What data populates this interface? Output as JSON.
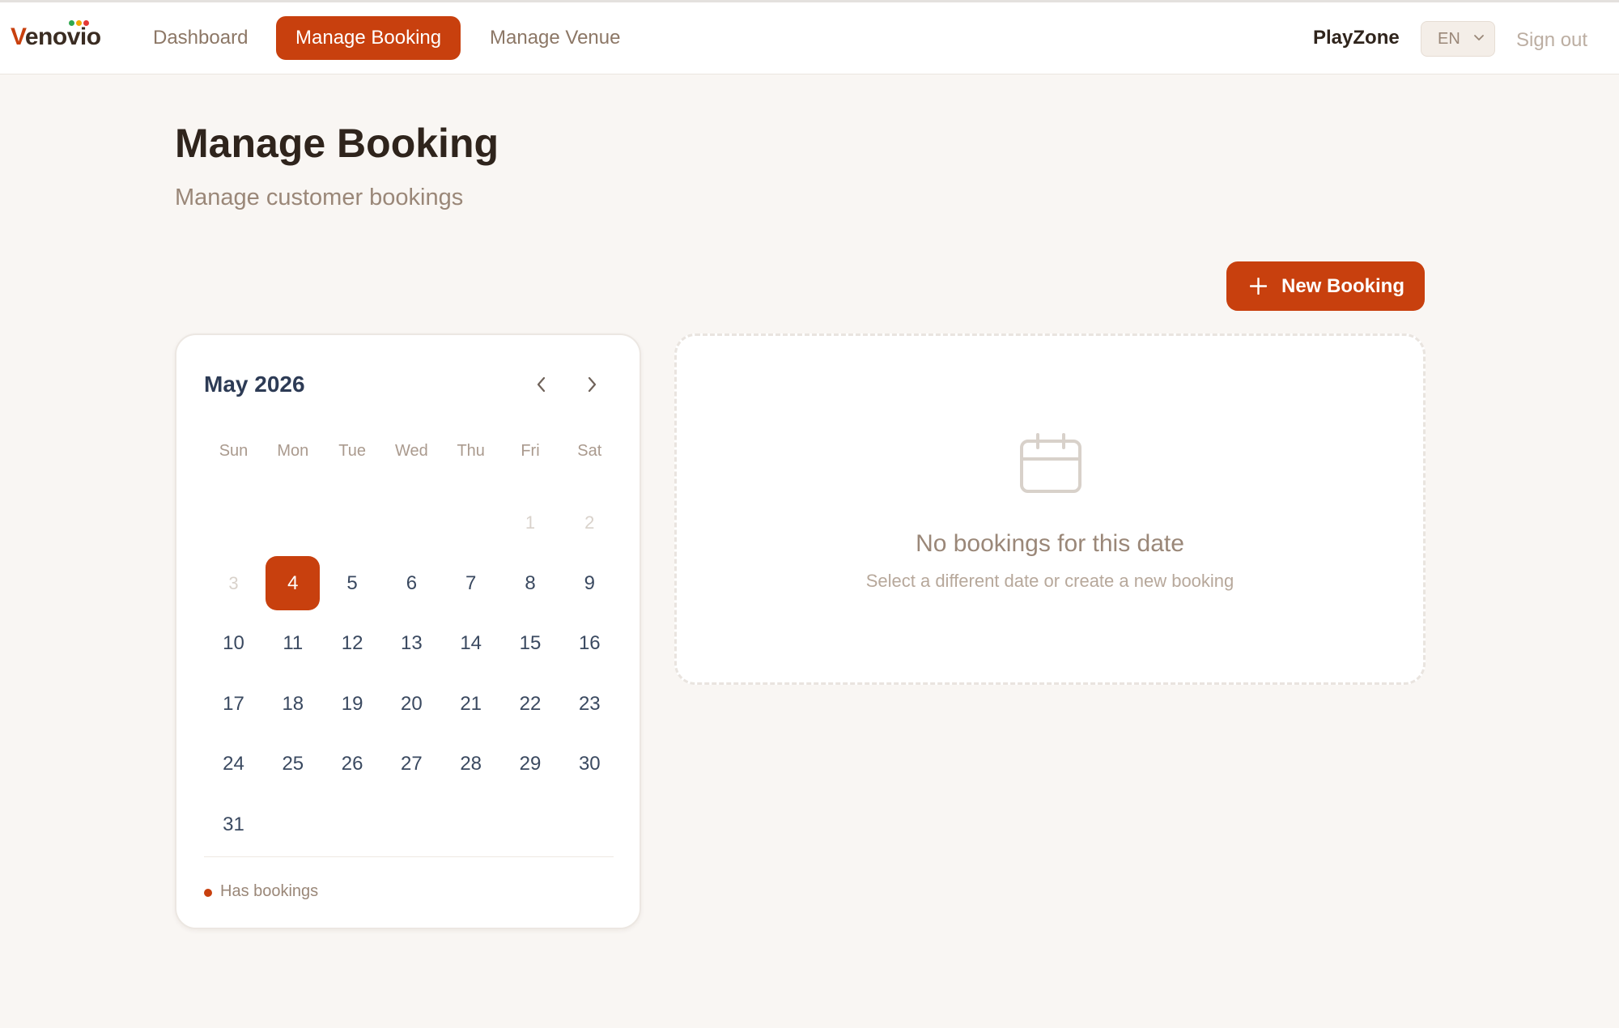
{
  "app": {
    "logo_text": "Venovio",
    "logo_first": "V",
    "logo_rest": "enovio"
  },
  "nav": {
    "items": [
      {
        "label": "Dashboard",
        "active": false
      },
      {
        "label": "Manage Booking",
        "active": true
      },
      {
        "label": "Manage Venue",
        "active": false
      }
    ],
    "brand_name": "PlayZone",
    "language": "EN",
    "sign_out": "Sign out"
  },
  "page": {
    "title": "Manage Booking",
    "subtitle": "Manage customer bookings",
    "new_booking_label": "New Booking"
  },
  "calendar": {
    "month_label": "May 2026",
    "weekdays": [
      "Sun",
      "Mon",
      "Tue",
      "Wed",
      "Thu",
      "Fri",
      "Sat"
    ],
    "weeks": [
      [
        "",
        "",
        "",
        "",
        "",
        "1",
        "2"
      ],
      [
        "3",
        "4",
        "5",
        "6",
        "7",
        "8",
        "9"
      ],
      [
        "10",
        "11",
        "12",
        "13",
        "14",
        "15",
        "16"
      ],
      [
        "17",
        "18",
        "19",
        "20",
        "21",
        "22",
        "23"
      ],
      [
        "24",
        "25",
        "26",
        "27",
        "28",
        "29",
        "30"
      ],
      [
        "31",
        "",
        "",
        "",
        "",
        "",
        ""
      ]
    ],
    "disabled_days": [
      "1",
      "2",
      "3"
    ],
    "selected_day": "4",
    "legend_label": "Has bookings"
  },
  "empty_state": {
    "title": "No bookings for this date",
    "subtitle": "Select a different date or create a new booking"
  },
  "colors": {
    "accent": "#c8400e",
    "background": "#f9f6f3",
    "text_dark": "#2f241c",
    "text_muted": "#9a8778",
    "logo_dots": [
      "#2fa84f",
      "#f2a900",
      "#e53935"
    ]
  },
  "icons": {
    "logo": "logo-dots-icon",
    "chevron_down": "chevron-down-icon",
    "prev_month": "chevron-left-icon",
    "next_month": "chevron-right-icon",
    "plus": "plus-icon",
    "empty_calendar": "calendar-icon"
  }
}
